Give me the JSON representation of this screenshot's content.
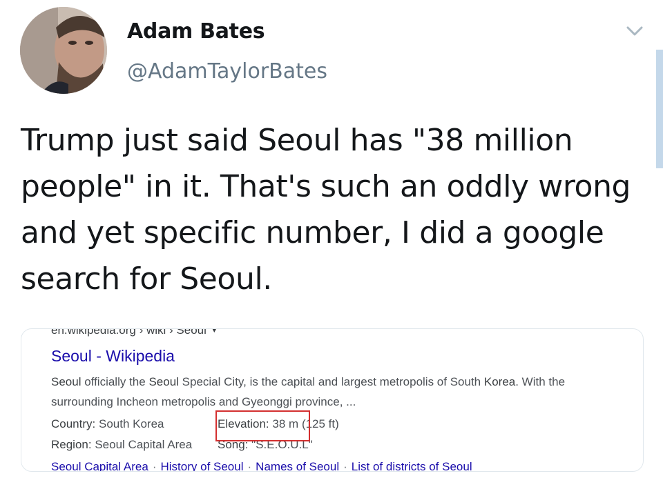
{
  "tweet": {
    "author_name": "Adam Bates",
    "author_handle": "@AdamTaylorBates",
    "text": "Trump just said Seoul has \"38 million people\" in it. That's such an oddly wrong and yet specific number, I did a google search for Seoul."
  },
  "search_result": {
    "breadcrumb": "en.wikipedia.org › wiki › Seoul",
    "title": "Seoul - Wikipedia",
    "snippet_parts": {
      "p1": "Seoul",
      "p2": " officially the ",
      "p3": "Seoul",
      "p4": " Special City, is the capital and largest metropolis of South ",
      "p5": "Korea",
      "p6": ". With the surrounding Incheon metropolis and Gyeonggi province, ..."
    },
    "facts": {
      "country_label": "Country:",
      "country_value": "South Korea",
      "region_label": "Region:",
      "region_value": "Seoul Capital Area",
      "elevation_label": "Elevation:",
      "elevation_value": "38 m",
      "elevation_extra": "(125 ft)",
      "song_label": "Song:",
      "song_value": "\"S.E.O.U.L\""
    },
    "related_links": [
      "Seoul Capital Area",
      "History of Seoul",
      "Names of Seoul",
      "List of districts of Seoul"
    ]
  },
  "colors": {
    "link": "#1a0dab",
    "highlight": "#d32f2f",
    "handle": "#657786"
  },
  "icons": {
    "menu": "chevron-down-icon"
  }
}
